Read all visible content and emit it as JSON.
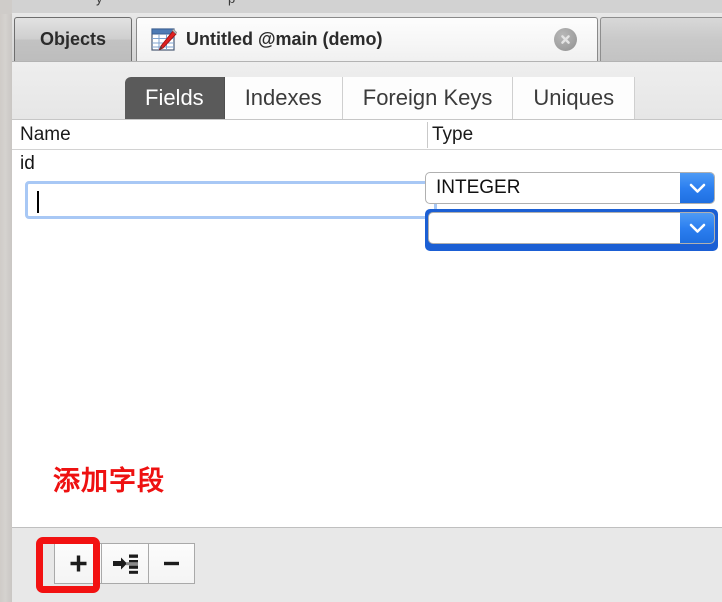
{
  "window": {
    "top_sliver_ghost_1": "y",
    "top_sliver_ghost_2": "p"
  },
  "tabs": {
    "items": [
      {
        "label": "Objects",
        "state": "inactive",
        "icon": ""
      },
      {
        "label": "Untitled @main (demo)",
        "state": "active",
        "icon": "table-edit-icon"
      },
      {
        "label": "",
        "state": "blank",
        "icon": ""
      }
    ],
    "close_icon": "close-icon"
  },
  "subtabs": {
    "items": [
      {
        "label": "Fields",
        "selected": true
      },
      {
        "label": "Indexes",
        "selected": false
      },
      {
        "label": "Foreign Keys",
        "selected": false
      },
      {
        "label": "Uniques",
        "selected": false
      }
    ]
  },
  "grid": {
    "columns": [
      "Name",
      "Type"
    ],
    "rows": [
      {
        "name": "id",
        "type": "INTEGER",
        "editing": false,
        "selected": false
      },
      {
        "name": "",
        "type": "",
        "editing": true,
        "selected": true
      }
    ],
    "name_input_placeholder": "",
    "type_combo_arrow_icon": "chevron-down-icon"
  },
  "annotation": {
    "text": "添加字段",
    "color": "#ee1111",
    "highlight_color": "#f21111",
    "highlight_target": "add-field-button"
  },
  "toolbar": {
    "buttons": [
      {
        "name": "add-field-button",
        "icon": "plus-icon",
        "label": "+"
      },
      {
        "name": "insert-field-button",
        "icon": "insert-field-icon",
        "label": ""
      },
      {
        "name": "remove-field-button",
        "icon": "minus-icon",
        "label": "−"
      }
    ]
  },
  "colors": {
    "accent_blue": "#2c7ff0",
    "selection_blue": "#1b5fd4",
    "focus_ring": "#a8c8f5",
    "subtab_selected_bg": "#5a5a5a",
    "annotation_red": "#ee1111"
  }
}
